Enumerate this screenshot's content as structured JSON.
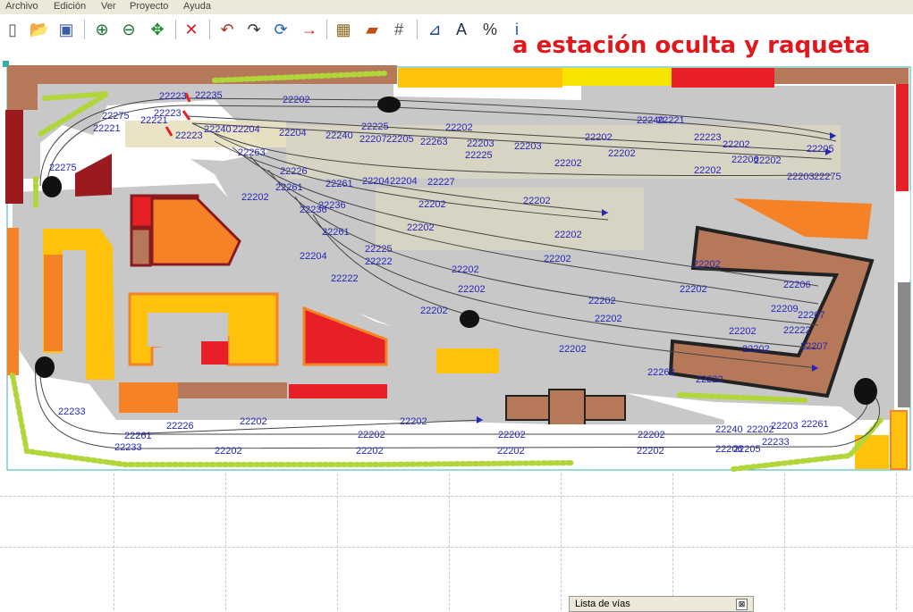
{
  "menu": [
    "Archivo",
    "Edición",
    "Ver",
    "Proyecto",
    "Ayuda"
  ],
  "toolbar": {
    "buttons": [
      {
        "name": "new-file-icon",
        "glyph": "▯",
        "color": "#555555"
      },
      {
        "name": "open-folder-icon",
        "glyph": "📂",
        "color": "#d9a300"
      },
      {
        "name": "save-icon",
        "glyph": "▣",
        "color": "#3a5fa8"
      },
      {
        "name": "zoom-in-icon",
        "glyph": "⊕",
        "color": "#1b6e2a"
      },
      {
        "name": "zoom-out-icon",
        "glyph": "⊖",
        "color": "#1b6e2a"
      },
      {
        "name": "move-icon",
        "glyph": "✥",
        "color": "#1b8f2a"
      },
      {
        "name": "delete-icon",
        "glyph": "✕",
        "color": "#d02020"
      },
      {
        "name": "rotate-left-icon",
        "glyph": "↶",
        "color": "#b03020"
      },
      {
        "name": "rotate-right-icon",
        "glyph": "↷",
        "color": "#333333"
      },
      {
        "name": "refresh-icon",
        "glyph": "⟳",
        "color": "#2060c0"
      },
      {
        "name": "arrow-right-icon",
        "glyph": "→",
        "color": "#d02020"
      },
      {
        "name": "calculator-icon",
        "glyph": "▦",
        "color": "#8a6a20"
      },
      {
        "name": "measure-icon",
        "glyph": "▰",
        "color": "#c05010"
      },
      {
        "name": "grid-icon",
        "glyph": "#",
        "color": "#555555"
      },
      {
        "name": "chart-icon",
        "glyph": "⊿",
        "color": "#2040a0"
      },
      {
        "name": "text-icon",
        "glyph": "A",
        "color": "#203050"
      },
      {
        "name": "percent-icon",
        "glyph": "%",
        "color": "#333333"
      },
      {
        "name": "info-icon",
        "glyph": "i",
        "color": "#2050c0"
      }
    ]
  },
  "overlay_title": "a estación oculta y raqueta",
  "track_labels": [
    "22202",
    "22203",
    "22204",
    "22205",
    "22206",
    "22207",
    "22209",
    "22221",
    "22222",
    "22223",
    "22225",
    "22226",
    "22227",
    "22233",
    "22235",
    "22236",
    "22240",
    "22261",
    "22263",
    "22275"
  ],
  "panel": {
    "title": "Lista de vías",
    "close": "⊠"
  },
  "colors": {
    "red_title": "#e0171d",
    "track_label": "#2626b8",
    "floor": "#c8c8c8",
    "building_brown": "#b5795a",
    "building_yellow": "#fec20d",
    "building_orange": "#f58226",
    "building_red": "#e62026",
    "vegetation": "#b0d63a"
  }
}
